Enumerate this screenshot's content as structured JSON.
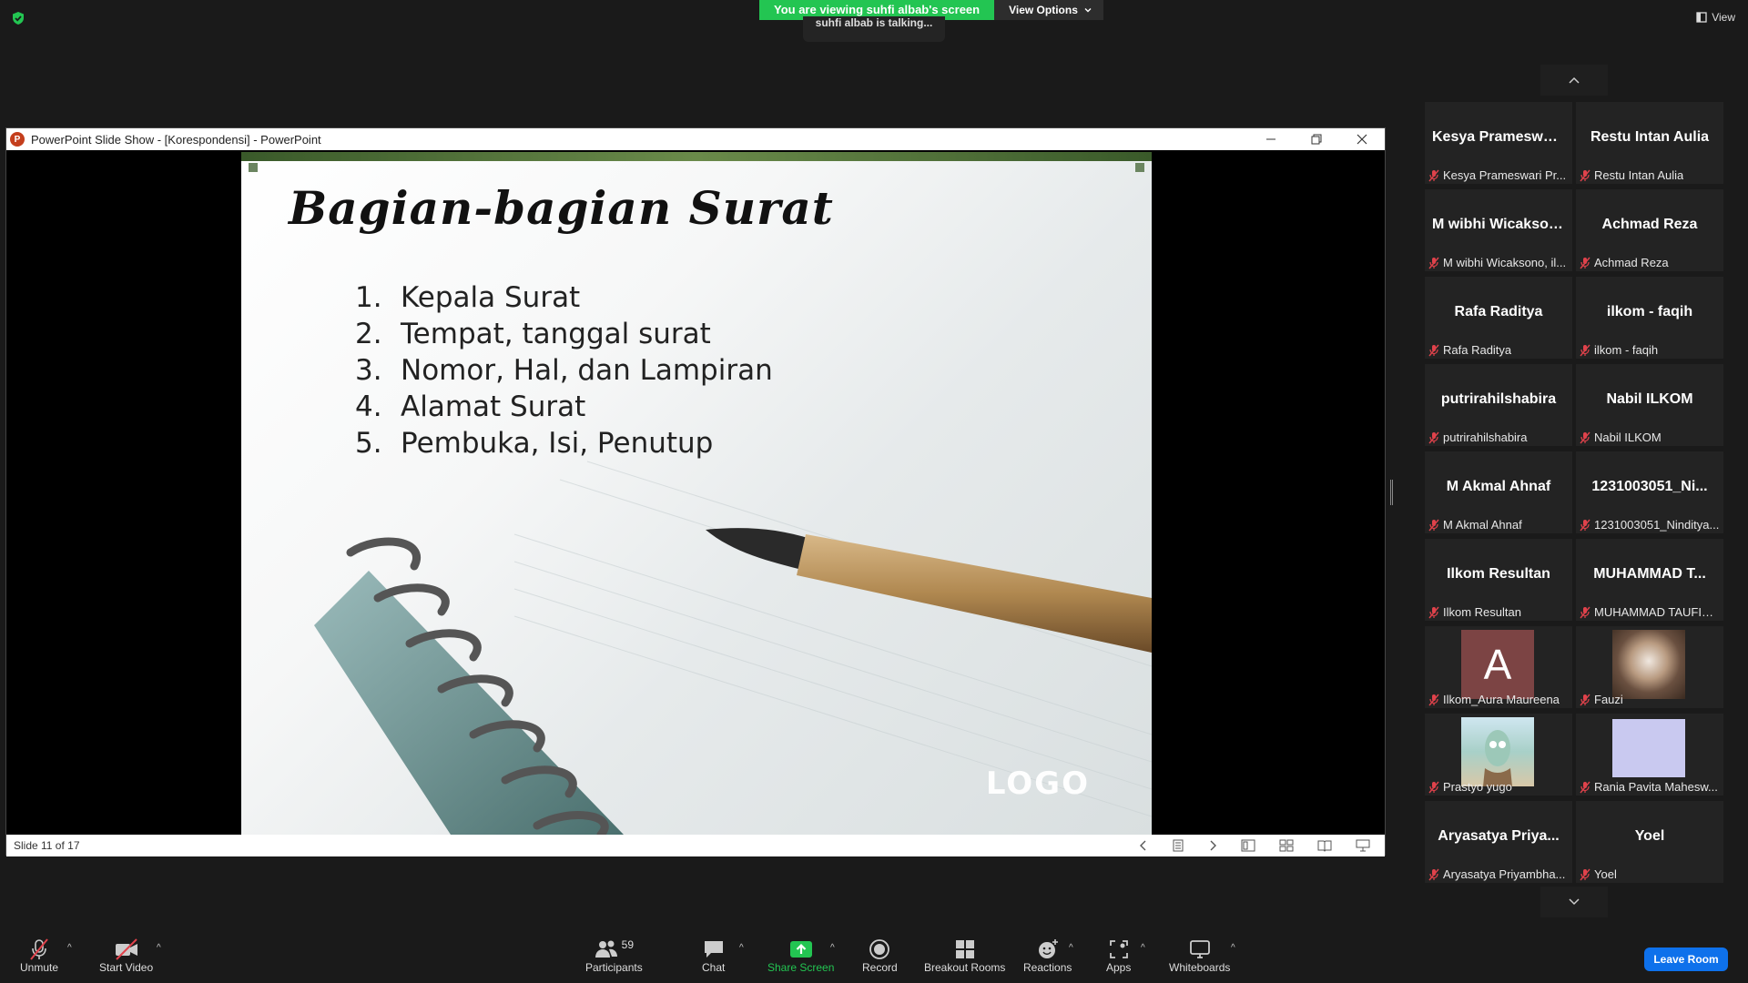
{
  "banner": {
    "viewing_text": "You are viewing suhfi albab's screen",
    "view_options_label": "View Options",
    "talking_text": "suhfi albab is talking...",
    "view_label": "View"
  },
  "ppt": {
    "window_title": "PowerPoint Slide Show - [Korespondensi] - PowerPoint",
    "status_text": "Slide 11 of 17",
    "slide": {
      "title": "Bagian-bagian Surat",
      "items": [
        {
          "num": "1.",
          "text": "Kepala Surat"
        },
        {
          "num": "2.",
          "text": "Tempat, tanggal surat"
        },
        {
          "num": "3.",
          "text": "Nomor, Hal, dan Lampiran"
        },
        {
          "num": "4.",
          "text": "Alamat Surat"
        },
        {
          "num": "5.",
          "text": "Pembuka, Isi, Penutup"
        }
      ],
      "logo": "LOGO"
    }
  },
  "participants": [
    {
      "big": "Kesya Prameswari Pr...",
      "name": "Kesya Prameswari Pr..."
    },
    {
      "big": "Restu Intan Aulia",
      "name": "Restu Intan Aulia"
    },
    {
      "big": "M wibhi Wicaksono, il...",
      "name": "M wibhi Wicaksono, il..."
    },
    {
      "big": "Achmad Reza",
      "name": "Achmad Reza"
    },
    {
      "big": "Rafa Raditya",
      "name": "Rafa Raditya"
    },
    {
      "big": "ilkom - faqih",
      "name": "ilkom - faqih"
    },
    {
      "big": "putrirahilshabira",
      "name": "putrirahilshabira"
    },
    {
      "big": "Nabil ILKOM",
      "name": "Nabil ILKOM"
    },
    {
      "big": "M Akmal Ahnaf",
      "name": "M Akmal Ahnaf"
    },
    {
      "big": "1231003051_Ni...",
      "name": "1231003051_Ninditya..."
    },
    {
      "big": "Ilkom Resultan",
      "name": "Ilkom Resultan"
    },
    {
      "big": "MUHAMMAD T...",
      "name": "MUHAMMAD TAUFIQ..."
    },
    {
      "avatar_letter": "A",
      "name": "Ilkom_Aura Maureena"
    },
    {
      "name": "Fauzi"
    },
    {
      "name": "Prastyo yugo"
    },
    {
      "name": "Rania Pavita Mahesw..."
    },
    {
      "big": "Aryasatya Priya...",
      "name": "Aryasatya Priyambha..."
    },
    {
      "big": "Yoel",
      "name": "Yoel"
    }
  ],
  "toolbar": {
    "unmute": "Unmute",
    "start_video": "Start Video",
    "participants": "Participants",
    "participant_count": "59",
    "chat": "Chat",
    "share_screen": "Share Screen",
    "record": "Record",
    "breakout_rooms": "Breakout Rooms",
    "reactions": "Reactions",
    "apps": "Apps",
    "whiteboards": "Whiteboards",
    "leave_room": "Leave Room"
  },
  "colors": {
    "share_green": "#23c552",
    "leave_blue": "#0e71eb",
    "mute_red": "#e0424b"
  }
}
